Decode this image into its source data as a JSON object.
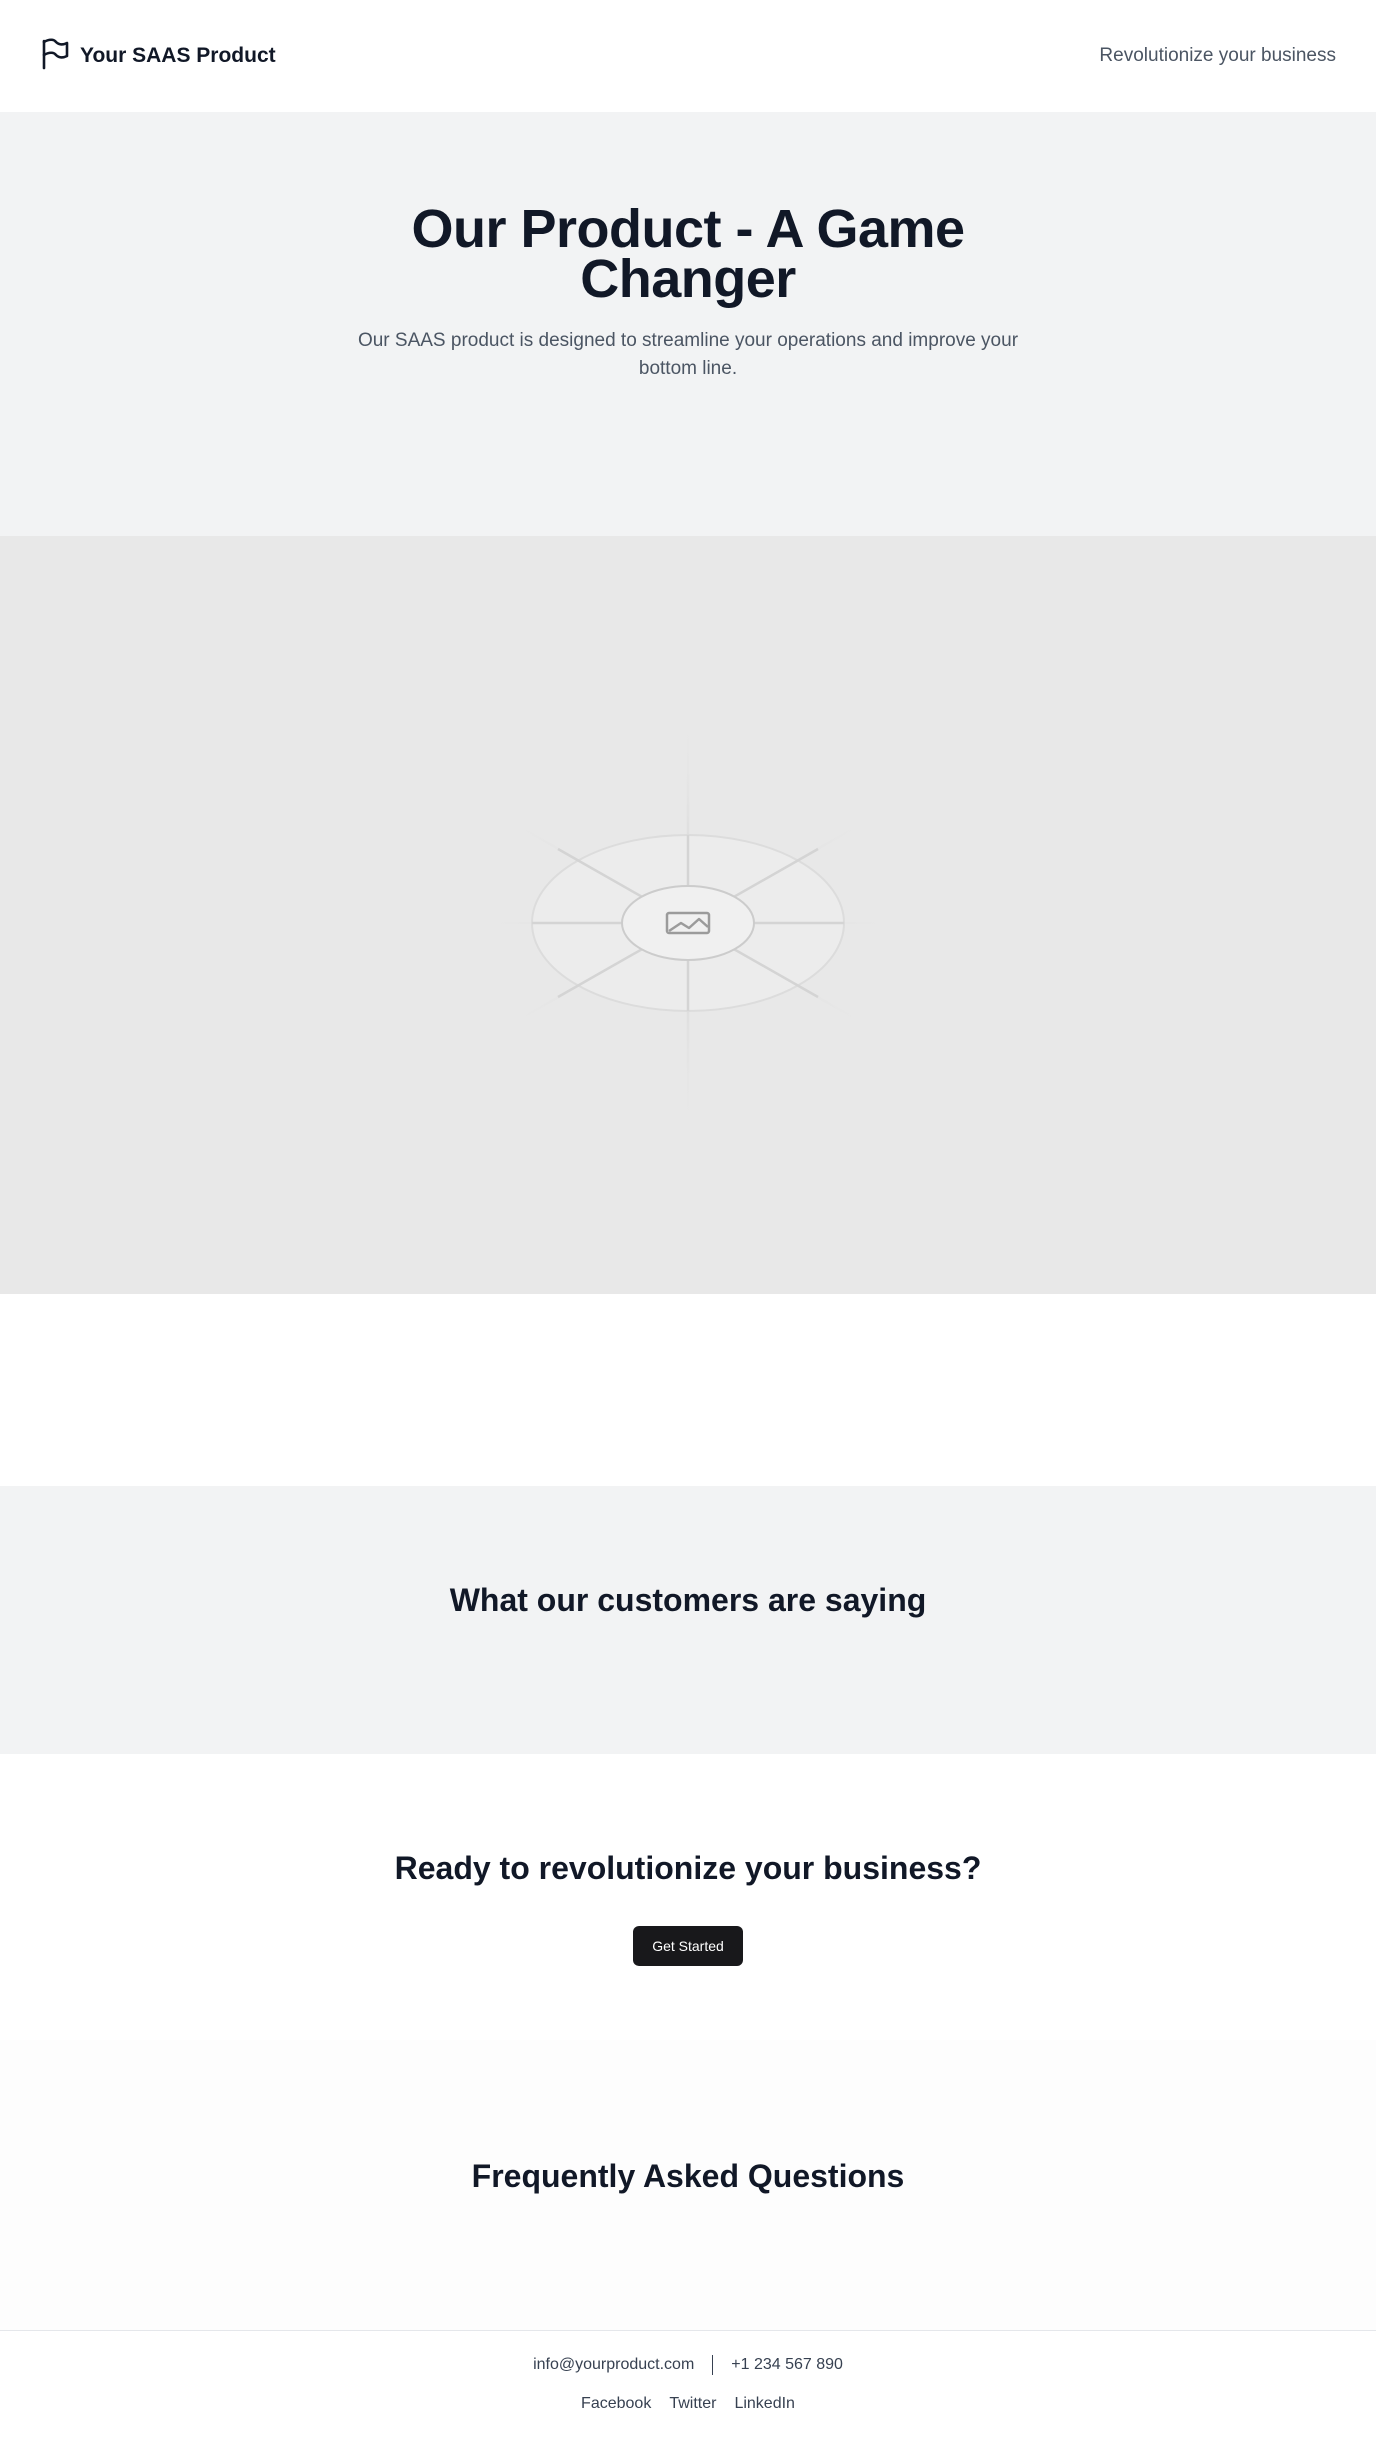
{
  "header": {
    "brand": "Your SAAS Product",
    "tagline": "Revolutionize your business",
    "logo_icon": "flag-icon"
  },
  "hero": {
    "title": "Our Product - A Game Changer",
    "subtitle": "Our SAAS product is designed to streamline your operations and improve your bottom line.",
    "image_icon": "image-placeholder-icon"
  },
  "testimonials": {
    "title": "What our customers are saying"
  },
  "cta": {
    "title": "Ready to revolutionize your business?",
    "button_label": "Get Started"
  },
  "faq": {
    "title": "Frequently Asked Questions"
  },
  "footer": {
    "email": "info@yourproduct.com",
    "phone": "+1 234 567 890",
    "links": [
      "Facebook",
      "Twitter",
      "LinkedIn"
    ]
  },
  "colors": {
    "text": "#111827",
    "muted": "#4b5563",
    "section_bg": "#f2f3f4",
    "button_bg": "#18181b"
  }
}
